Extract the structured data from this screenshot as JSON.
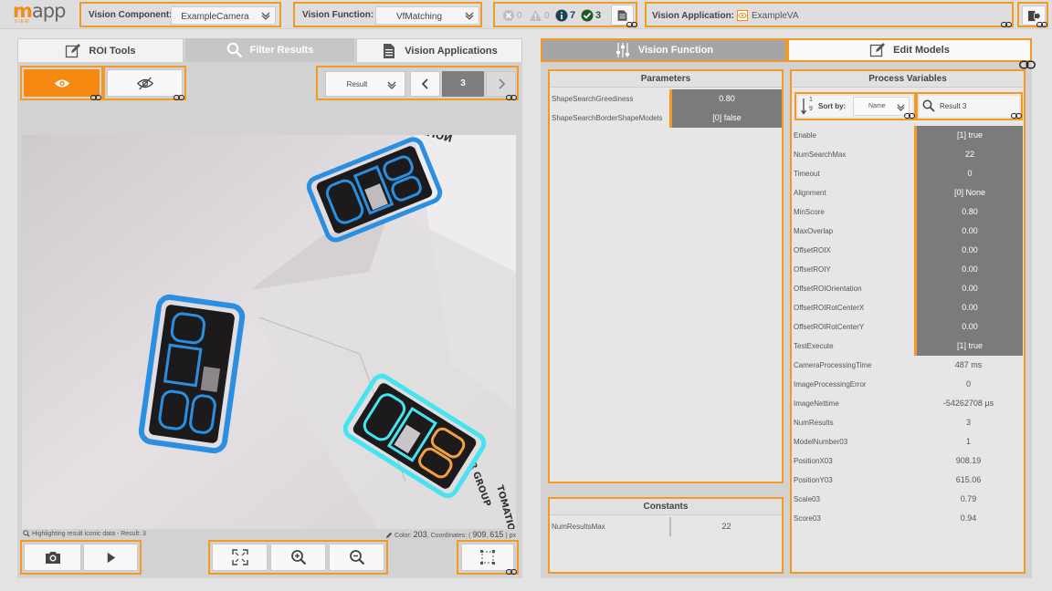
{
  "logo": {
    "brand_a": "m",
    "brand_b": "app",
    "sub": "VIEW"
  },
  "top": {
    "component_label": "Vision Component:",
    "component_value": "ExampleCamera",
    "function_label": "Vision Function:",
    "function_value": "VfMatching",
    "status": {
      "errors": "0",
      "warnings": "0",
      "info": "7",
      "ok": "3"
    },
    "application_label": "Vision Application:",
    "application_value": "ExampleVA"
  },
  "left": {
    "tabs": [
      "ROI Tools",
      "Filter Results",
      "Vision Applications"
    ],
    "result_select": "Result",
    "result_index": "3",
    "status_text": "Highlighting result iconic data - Result: 3",
    "color_label": "Color:",
    "color_value": "203",
    "coords_label": "Coordinates: (",
    "coord_x": "909",
    "coord_y": "615",
    "coord_unit": ") px"
  },
  "right": {
    "tabs": [
      "Vision Function",
      "Edit Models"
    ],
    "parameters_title": "Parameters",
    "parameters": [
      {
        "name": "ShapeSearchGreediness",
        "value": "0.80"
      },
      {
        "name": "ShapeSearchBorderShapeModels",
        "value": "[0] false"
      }
    ],
    "constants_title": "Constants",
    "constants": [
      {
        "name": "NumResultsMax",
        "value": "22"
      }
    ],
    "process_title": "Process Variables",
    "sort_label": "Sort by:",
    "sort_value": "Name",
    "sort_icon_top": "1",
    "sort_icon_bottom": "9",
    "search_value": "Result 3",
    "process_vars": [
      {
        "name": "Enable",
        "value": "[1] true",
        "editable": true
      },
      {
        "name": "NumSearchMax",
        "value": "22",
        "editable": true
      },
      {
        "name": "Timeout",
        "value": "0",
        "editable": true
      },
      {
        "name": "Alignment",
        "value": "[0] None",
        "editable": true
      },
      {
        "name": "MinScore",
        "value": "0.80",
        "editable": true
      },
      {
        "name": "MaxOverlap",
        "value": "0.00",
        "editable": true
      },
      {
        "name": "OffsetROIX",
        "value": "0.00",
        "editable": true
      },
      {
        "name": "OffsetROIY",
        "value": "0.00",
        "editable": true
      },
      {
        "name": "OffsetROIOrientation",
        "value": "0.00",
        "editable": true
      },
      {
        "name": "OffsetROIRotCenterX",
        "value": "0.00",
        "editable": true
      },
      {
        "name": "OffsetROIRotCenterY",
        "value": "0.00",
        "editable": true
      },
      {
        "name": "TestExecute",
        "value": "[1] true",
        "editable": true
      },
      {
        "name": "CameraProcessingTime",
        "value": "487 ms",
        "editable": false
      },
      {
        "name": "ImageProcessingError",
        "value": "0",
        "editable": false
      },
      {
        "name": "ImageNettime",
        "value": "-54262708 µs",
        "editable": false
      },
      {
        "name": "NumResults",
        "value": "3",
        "editable": false
      },
      {
        "name": "ModelNumber03",
        "value": "1",
        "editable": false
      },
      {
        "name": "PositionX03",
        "value": "908.19",
        "editable": false
      },
      {
        "name": "PositionY03",
        "value": "615.06",
        "editable": false
      },
      {
        "name": "Scale03",
        "value": "0.79",
        "editable": false
      },
      {
        "name": "Score03",
        "value": "0.94",
        "editable": false
      }
    ]
  },
  "image_text": {
    "top_print": "NOITAMOTION",
    "bottom_print_a": "R GROUP",
    "bottom_print_b": "TOMATION"
  },
  "colors": {
    "accent": "#f39a26",
    "brand": "#f28c14",
    "match_blue": "#2a8fe0",
    "match_cyan": "#46e4f0"
  }
}
